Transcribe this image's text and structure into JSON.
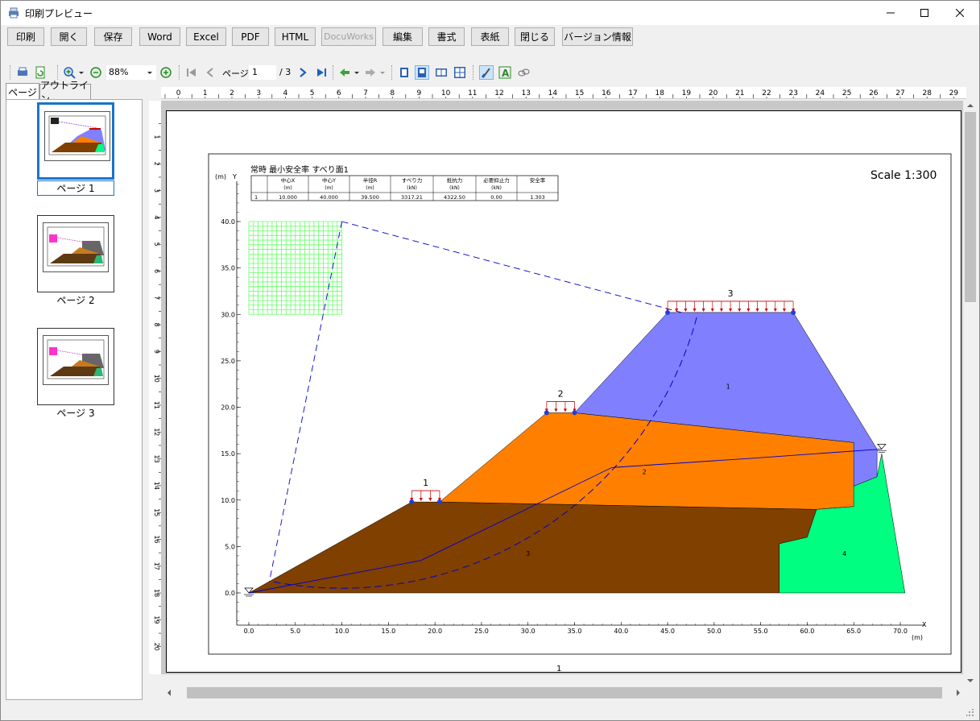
{
  "window": {
    "title": "印刷プレビュー"
  },
  "toolbar": {
    "buttons": [
      "印刷",
      "開く",
      "保存",
      "Word",
      "Excel",
      "PDF",
      "HTML",
      "DocuWorks",
      "編集",
      "書式",
      "表紙",
      "閉じる",
      "バージョン情報"
    ]
  },
  "toolbar2": {
    "zoom": "88%",
    "page_label": "ページ",
    "page_value": "1",
    "page_total": "/ 3"
  },
  "sidebar": {
    "tabs": [
      "ページ",
      "アウトライン"
    ],
    "pages": [
      "ページ 1",
      "ページ 2",
      "ページ 3"
    ]
  },
  "ruler": {
    "h_ticks": [
      "0",
      "1",
      "2",
      "3",
      "4",
      "5",
      "6",
      "7",
      "8",
      "9",
      "10",
      "11",
      "12",
      "13",
      "14",
      "15",
      "16",
      "17",
      "18",
      "19",
      "20",
      "21",
      "22",
      "23",
      "24",
      "25",
      "26",
      "27",
      "28",
      "29"
    ],
    "v_ticks": [
      "1",
      "2",
      "3",
      "4",
      "5",
      "6",
      "7",
      "8",
      "9",
      "10",
      "11",
      "12",
      "13",
      "14",
      "15",
      "16",
      "17",
      "18",
      "19",
      "20"
    ]
  },
  "document": {
    "title": "常時 最小安全率 すべり面1",
    "scale": "Scale 1:300",
    "page_number": "1",
    "table": {
      "headers": [
        "中心X",
        "中心Y",
        "半径R",
        "すべり力",
        "抵抗力",
        "必要抑止力",
        "安全率"
      ],
      "units": [
        "(m)",
        "(m)",
        "(m)",
        "(kN)",
        "(kN)",
        "(kN)",
        ""
      ],
      "rows": [
        [
          "1",
          "10.000",
          "40.000",
          "39.500",
          "3317.21",
          "4322.50",
          "0.00",
          "1.303"
        ]
      ]
    },
    "axis_y_label": "(m)",
    "axis_y_name": "Y",
    "axis_x_label": "(m)",
    "axis_x_name": "X",
    "load_labels": [
      "1",
      "2",
      "3"
    ],
    "layer_labels": [
      "1",
      "2",
      "3",
      "4"
    ]
  },
  "chart_data": {
    "type": "scatter",
    "x_ticks": [
      "0.0",
      "5.0",
      "10.0",
      "15.0",
      "20.0",
      "25.0",
      "30.0",
      "35.0",
      "40.0",
      "45.0",
      "50.0",
      "55.0",
      "60.0",
      "65.0",
      "70.0"
    ],
    "y_ticks": [
      "0.0",
      "5.0",
      "10.0",
      "15.0",
      "20.0",
      "25.0",
      "30.0",
      "35.0",
      "40.0"
    ],
    "xlim": [
      0,
      70
    ],
    "ylim": [
      0,
      40
    ],
    "grid": false
  },
  "colors": {
    "layer1": "#8080ff",
    "layer2": "#ff8000",
    "layer3": "#804000",
    "layer4": "#00ff80",
    "slip_circle": "#0000cc",
    "load": "#cc0000",
    "search_grid": "#66ff66"
  }
}
